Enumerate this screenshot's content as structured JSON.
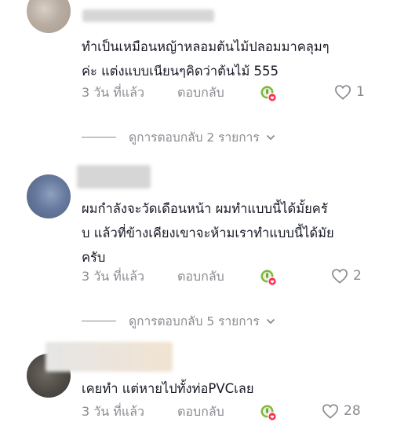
{
  "comments": [
    {
      "text": "ทำเป็นเหมือนหญ้าหลอมต้นไม้ปลอมมาคลุมๆ\nค่ะ แต่งแบบเนียนๆคิดว่าต้นไม้ 555",
      "time": "3 วัน ที่แล้ว",
      "reply_label": "ตอบกลับ",
      "likes": "1",
      "view_replies": "ดูการตอบกลับ 2 รายการ"
    },
    {
      "text": "ผมกำลังจะวัดเดือนหน้า ผมทำแบบนี้ได้มั้ยครั\nบ แล้วที่ข้างเคียงเขาจะห้ามเราทำแบบนี้ได้มัย\nครับ",
      "time": "3 วัน ที่แล้ว",
      "reply_label": "ตอบกลับ",
      "likes": "2",
      "view_replies": "ดูการตอบกลับ 5 รายการ"
    },
    {
      "text": "เคยทำ แต่หายไปทั้งท่อPVCเลย",
      "time": "3 วัน ที่แล้ว",
      "reply_label": "ตอบกลับ",
      "likes": "28"
    }
  ],
  "colors": {
    "text": "#161823",
    "muted": "#8a8b91",
    "creator_badge_green": "#7fb83a",
    "heart_red": "#fe2c55"
  },
  "icons": [
    "creator-liked-icon",
    "heart-outline-icon",
    "chevron-down-icon"
  ]
}
